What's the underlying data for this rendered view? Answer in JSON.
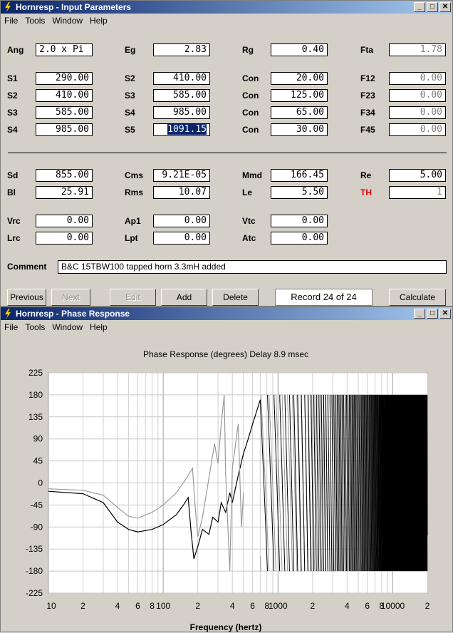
{
  "win1": {
    "title": "Hornresp - Input Parameters",
    "menu": [
      "File",
      "Tools",
      "Window",
      "Help"
    ],
    "params": {
      "ang": {
        "label": "Ang",
        "value": "2.0 x Pi"
      },
      "eg": {
        "label": "Eg",
        "value": "2.83"
      },
      "rg": {
        "label": "Rg",
        "value": "0.40"
      },
      "fta": {
        "label": "Fta",
        "value": "1.78"
      },
      "s1a": {
        "label": "S1",
        "value": "290.00"
      },
      "s2b": {
        "label": "S2",
        "value": "410.00"
      },
      "con1": {
        "label": "Con",
        "value": "20.00"
      },
      "f12": {
        "label": "F12",
        "value": "0.00"
      },
      "s2a": {
        "label": "S2",
        "value": "410.00"
      },
      "s3b": {
        "label": "S3",
        "value": "585.00"
      },
      "con2": {
        "label": "Con",
        "value": "125.00"
      },
      "f23": {
        "label": "F23",
        "value": "0.00"
      },
      "s3a": {
        "label": "S3",
        "value": "585.00"
      },
      "s4b": {
        "label": "S4",
        "value": "985.00"
      },
      "con3": {
        "label": "Con",
        "value": "65.00"
      },
      "f34": {
        "label": "F34",
        "value": "0.00"
      },
      "s4a": {
        "label": "S4",
        "value": "985.00"
      },
      "s5b": {
        "label": "S5",
        "value": "1091.15"
      },
      "con4": {
        "label": "Con",
        "value": "30.00"
      },
      "f45": {
        "label": "F45",
        "value": "0.00"
      },
      "sd": {
        "label": "Sd",
        "value": "855.00"
      },
      "cms": {
        "label": "Cms",
        "value": "9.21E-05"
      },
      "mmd": {
        "label": "Mmd",
        "value": "166.45"
      },
      "re": {
        "label": "Re",
        "value": "5.00"
      },
      "bl": {
        "label": "Bl",
        "value": "25.91"
      },
      "rms": {
        "label": "Rms",
        "value": "10.07"
      },
      "le": {
        "label": "Le",
        "value": "5.50"
      },
      "th": {
        "label": "TH",
        "value": "1"
      },
      "vrc": {
        "label": "Vrc",
        "value": "0.00"
      },
      "ap1": {
        "label": "Ap1",
        "value": "0.00"
      },
      "vtc": {
        "label": "Vtc",
        "value": "0.00"
      },
      "lrc": {
        "label": "Lrc",
        "value": "0.00"
      },
      "lpt": {
        "label": "Lpt",
        "value": "0.00"
      },
      "atc": {
        "label": "Atc",
        "value": "0.00"
      }
    },
    "comment_label": "Comment",
    "comment": "B&C 15TBW100 tapped horn  3.3mH added",
    "buttons": {
      "previous": "Previous",
      "next": "Next",
      "edit": "Edit",
      "add": "Add",
      "delete": "Delete",
      "calculate": "Calculate"
    },
    "record": "Record 24 of 24"
  },
  "win2": {
    "title": "Hornresp - Phase Response",
    "menu": [
      "File",
      "Tools",
      "Window",
      "Help"
    ]
  },
  "chart_data": {
    "type": "line",
    "title": "Phase Response (degrees)   Delay 8.9 msec",
    "xlabel": "Frequency (hertz)",
    "ylabel": "",
    "xscale": "log",
    "xlim": [
      10,
      20000
    ],
    "ylim": [
      -225,
      225
    ],
    "yticks": [
      225,
      180,
      135,
      90,
      45,
      0,
      -45,
      -90,
      -135,
      -180,
      -225
    ],
    "xtick_labels": [
      "10",
      "2",
      "4",
      "6",
      "8",
      "100",
      "2",
      "4",
      "6",
      "8",
      "1000",
      "2",
      "4",
      "6",
      "8",
      "10000",
      "2"
    ],
    "grid": true,
    "series": [
      {
        "color": "#000000",
        "points": [
          [
            10,
            -17
          ],
          [
            20,
            -22
          ],
          [
            30,
            -40
          ],
          [
            40,
            -80
          ],
          [
            50,
            -95
          ],
          [
            60,
            -100
          ],
          [
            80,
            -95
          ],
          [
            100,
            -85
          ],
          [
            130,
            -65
          ],
          [
            150,
            -45
          ],
          [
            165,
            -30
          ],
          [
            175,
            -100
          ],
          [
            185,
            -155
          ],
          [
            200,
            -130
          ],
          [
            220,
            -95
          ],
          [
            250,
            -105
          ],
          [
            270,
            -70
          ],
          [
            300,
            -80
          ],
          [
            320,
            -40
          ],
          [
            350,
            -60
          ],
          [
            380,
            -20
          ],
          [
            400,
            -40
          ],
          [
            450,
            15
          ],
          [
            500,
            60
          ],
          [
            550,
            90
          ],
          [
            600,
            120
          ],
          [
            700,
            170
          ]
        ]
      },
      {
        "color": "#9a9a9a",
        "points": [
          [
            10,
            -12
          ],
          [
            20,
            -15
          ],
          [
            30,
            -25
          ],
          [
            40,
            -50
          ],
          [
            50,
            -68
          ],
          [
            60,
            -72
          ],
          [
            80,
            -60
          ],
          [
            100,
            -45
          ],
          [
            130,
            -20
          ],
          [
            160,
            10
          ],
          [
            180,
            30
          ],
          [
            190,
            -50
          ],
          [
            200,
            -110
          ],
          [
            220,
            -70
          ],
          [
            250,
            10
          ],
          [
            280,
            80
          ],
          [
            300,
            40
          ],
          [
            320,
            120
          ],
          [
            340,
            180
          ],
          [
            350,
            20
          ],
          [
            380,
            -180
          ],
          [
            400,
            30
          ],
          [
            450,
            120
          ],
          [
            480,
            -90
          ],
          [
            500,
            -20
          ]
        ]
      }
    ],
    "wrapping_oscillation": {
      "from_hz": 700,
      "to_hz": 20000,
      "range": [
        -180,
        180
      ]
    }
  }
}
